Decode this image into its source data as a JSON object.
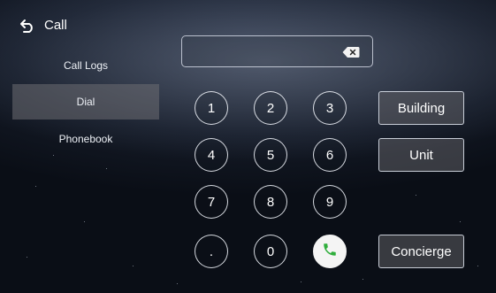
{
  "header": {
    "title": "Call"
  },
  "sidebar": {
    "items": [
      {
        "label": "Call Logs"
      },
      {
        "label": "Dial"
      },
      {
        "label": "Phonebook"
      }
    ]
  },
  "dialpad": {
    "number_value": "",
    "keys": [
      "1",
      "2",
      "3",
      "4",
      "5",
      "6",
      "7",
      "8",
      "9",
      ".",
      "0"
    ]
  },
  "actions": {
    "building": "Building",
    "unit": "Unit",
    "concierge": "Concierge"
  },
  "colors": {
    "call_icon": "#2fae3c",
    "active_item_bg": "#6e6e73"
  }
}
